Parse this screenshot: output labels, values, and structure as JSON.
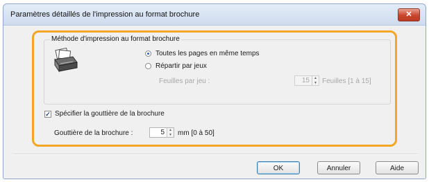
{
  "window": {
    "title": "Paramètres détaillés de l'impression au format brochure",
    "close_label": "✕"
  },
  "method_group": {
    "legend": "Méthode d'impression au format brochure",
    "options": [
      {
        "label": "Toutes les pages en même temps",
        "selected": true
      },
      {
        "label": "Répartir par jeux",
        "selected": false
      }
    ],
    "sheets_per_set": {
      "label": "Feuilles par jeu :",
      "value": "15",
      "unit": "Feuilles [1 à 15]"
    }
  },
  "gutter": {
    "checkbox_label": "Spécifier la gouttière de la brochure",
    "checked": true,
    "field_label": "Gouttière de la brochure :",
    "value": "5",
    "unit": "mm [0 à 50]"
  },
  "buttons": {
    "ok": "OK",
    "cancel": "Annuler",
    "help": "Aide"
  },
  "colors": {
    "highlight": "#f2a623",
    "close_button": "#c9452e"
  }
}
